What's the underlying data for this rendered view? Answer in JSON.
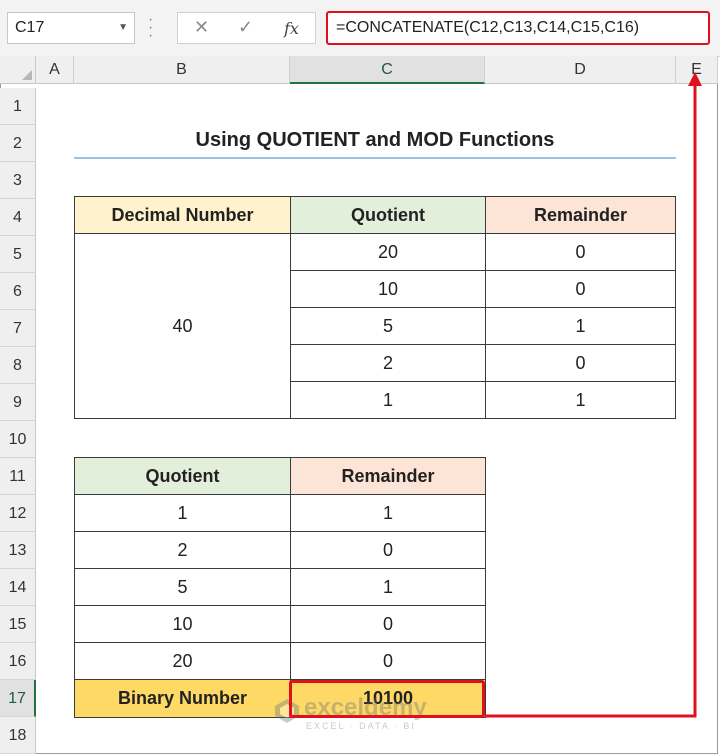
{
  "formula_bar": {
    "name_box": "C17",
    "cancel_icon": "✕",
    "enter_icon": "✓",
    "fx_icon": "fx",
    "formula": "=CONCATENATE(C12,C13,C14,C15,C16)"
  },
  "columns": [
    "A",
    "B",
    "C",
    "D",
    "E"
  ],
  "rows": [
    "1",
    "2",
    "3",
    "4",
    "5",
    "6",
    "7",
    "8",
    "9",
    "10",
    "11",
    "12",
    "13",
    "14",
    "15",
    "16",
    "17",
    "18"
  ],
  "active_cell": {
    "column": "C",
    "row": "17"
  },
  "title": "Using QUOTIENT and MOD Functions",
  "table1": {
    "headers": [
      "Decimal Number",
      "Quotient",
      "Remainder"
    ],
    "decimal_number": "40",
    "rows": [
      [
        "20",
        "0"
      ],
      [
        "10",
        "0"
      ],
      [
        "5",
        "1"
      ],
      [
        "2",
        "0"
      ],
      [
        "1",
        "1"
      ]
    ]
  },
  "table2": {
    "headers": [
      "Quotient",
      "Remainder"
    ],
    "rows": [
      [
        "1",
        "1"
      ],
      [
        "2",
        "0"
      ],
      [
        "5",
        "1"
      ],
      [
        "10",
        "0"
      ],
      [
        "20",
        "0"
      ]
    ],
    "result_label": "Binary Number",
    "result_value": "10100"
  },
  "watermark": {
    "name": "exceldemy",
    "tagline": "EXCEL · DATA · BI"
  },
  "colors": {
    "highlight": "#e0101e",
    "header_yellow": "#fff2cc",
    "header_green": "#e2efda",
    "header_peach": "#fce4d6",
    "result_gold": "#ffd966"
  }
}
